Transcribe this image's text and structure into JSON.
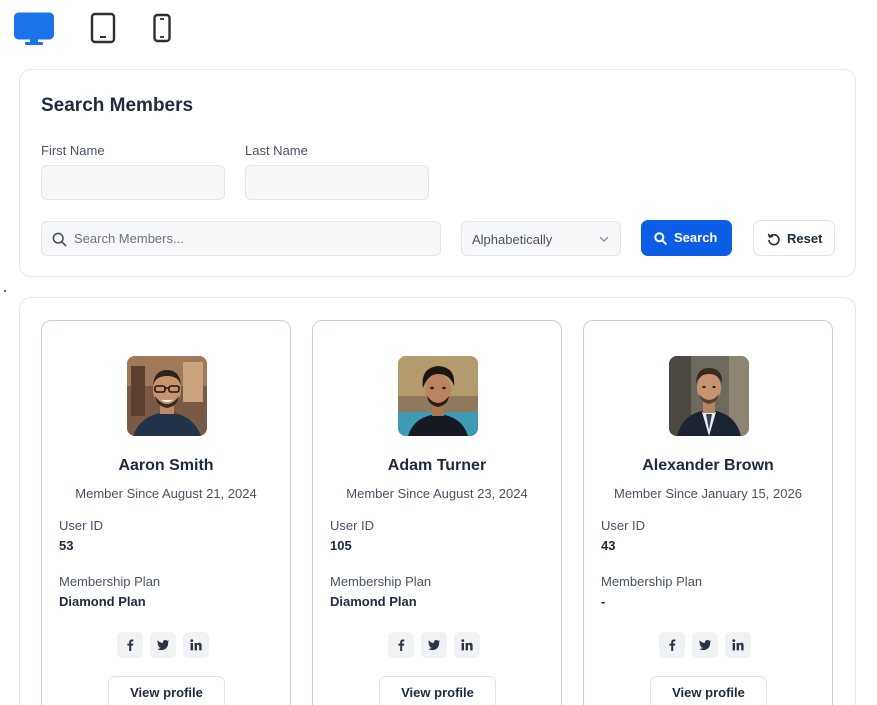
{
  "device_toolbar": {
    "items": [
      {
        "name": "desktop",
        "icon": "desktop-icon",
        "active": true
      },
      {
        "name": "tablet",
        "icon": "tablet-icon",
        "active": false
      },
      {
        "name": "mobile",
        "icon": "mobile-icon",
        "active": false
      }
    ]
  },
  "search_panel": {
    "title": "Search Members",
    "first_name_label": "First Name",
    "first_name_value": "",
    "last_name_label": "Last Name",
    "last_name_value": "",
    "search_placeholder": "Search Members...",
    "search_value": "",
    "sort_selected": "Alphabetically",
    "search_button": "Search",
    "reset_button": "Reset"
  },
  "members": [
    {
      "name": "Aaron Smith",
      "member_since": "Member Since August 21, 2024",
      "user_id_label": "User ID",
      "user_id": "53",
      "plan_label": "Membership Plan",
      "plan": "Diamond Plan",
      "view_profile": "View profile"
    },
    {
      "name": "Adam Turner",
      "member_since": "Member Since August 23, 2024",
      "user_id_label": "User ID",
      "user_id": "105",
      "plan_label": "Membership Plan",
      "plan": "Diamond Plan",
      "view_profile": "View profile"
    },
    {
      "name": "Alexander Brown",
      "member_since": "Member Since January 15, 2026",
      "user_id_label": "User ID",
      "user_id": "43",
      "plan_label": "Membership Plan",
      "plan": "-",
      "view_profile": "View profile"
    }
  ],
  "social_icons": [
    "facebook-icon",
    "twitter-icon",
    "linkedin-icon"
  ],
  "colors": {
    "accent": "#0d5ee6",
    "active_device": "#1a73e8",
    "text_primary": "#1f2a3c",
    "text_secondary": "#4a5262",
    "card_border": "#c8cfdb"
  }
}
